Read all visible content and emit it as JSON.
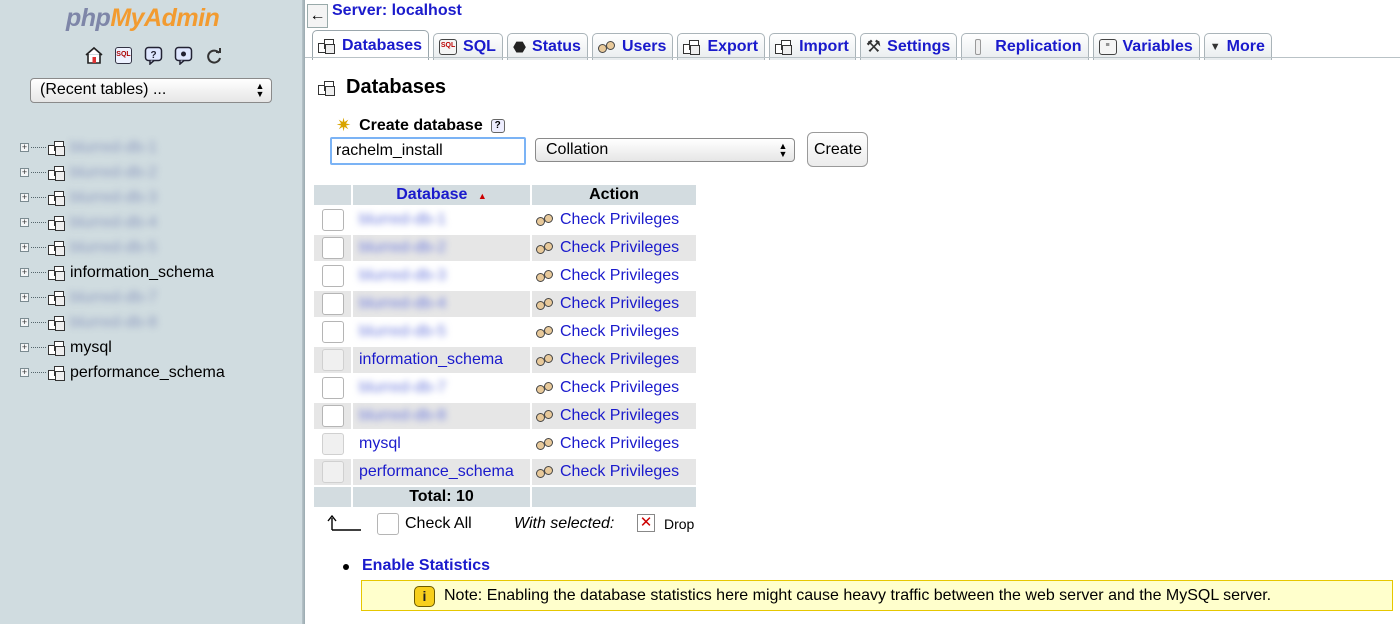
{
  "nav": {
    "logo_part1": "php",
    "logo_part2": "MyAdmin",
    "icons": [
      "home-icon",
      "sql-icon",
      "query-window-icon",
      "docs-icon",
      "reload-icon"
    ],
    "recent_tables": "(Recent tables) ...",
    "tree": [
      {
        "label": "blurred-db-1",
        "blurred": true
      },
      {
        "label": "blurred-db-2",
        "blurred": true
      },
      {
        "label": "blurred-db-3",
        "blurred": true
      },
      {
        "label": "blurred-db-4",
        "blurred": true
      },
      {
        "label": "blurred-db-5",
        "blurred": true
      },
      {
        "label": "information_schema",
        "blurred": false
      },
      {
        "label": "blurred-db-7",
        "blurred": true
      },
      {
        "label": "blurred-db-8",
        "blurred": true
      },
      {
        "label": "mysql",
        "blurred": false
      },
      {
        "label": "performance_schema",
        "blurred": false
      }
    ]
  },
  "header": {
    "back_arrow": "←",
    "breadcrumb": "Server: localhost"
  },
  "tabs": [
    {
      "label": "Databases",
      "icon": "databases-icon",
      "active": true
    },
    {
      "label": "SQL",
      "icon": "sql-icon",
      "active": false
    },
    {
      "label": "Status",
      "icon": "status-icon",
      "active": false
    },
    {
      "label": "Users",
      "icon": "users-icon",
      "active": false
    },
    {
      "label": "Export",
      "icon": "export-icon",
      "active": false
    },
    {
      "label": "Import",
      "icon": "import-icon",
      "active": false
    },
    {
      "label": "Settings",
      "icon": "settings-icon",
      "active": false
    },
    {
      "label": "Replication",
      "icon": "replication-icon",
      "active": false
    },
    {
      "label": "Variables",
      "icon": "variables-icon",
      "active": false
    },
    {
      "label": "More",
      "icon": "chevron-down-icon",
      "active": false
    }
  ],
  "page": {
    "title": "Databases",
    "create_label": "Create database",
    "dbname_value": "rachelm_install",
    "collation_value": "Collation",
    "create_button": "Create"
  },
  "table": {
    "columns": [
      "Database",
      "Action"
    ],
    "sort_indicator": "▲",
    "rows": [
      {
        "name": "blurred-db-1",
        "blurred": true,
        "action": "Check Privileges"
      },
      {
        "name": "blurred-db-2",
        "blurred": true,
        "action": "Check Privileges"
      },
      {
        "name": "blurred-db-3",
        "blurred": true,
        "action": "Check Privileges"
      },
      {
        "name": "blurred-db-4",
        "blurred": true,
        "action": "Check Privileges"
      },
      {
        "name": "blurred-db-5",
        "blurred": true,
        "action": "Check Privileges"
      },
      {
        "name": "information_schema",
        "blurred": false,
        "action": "Check Privileges"
      },
      {
        "name": "blurred-db-7",
        "blurred": true,
        "action": "Check Privileges"
      },
      {
        "name": "blurred-db-8",
        "blurred": true,
        "action": "Check Privileges"
      },
      {
        "name": "mysql",
        "blurred": false,
        "action": "Check Privileges"
      },
      {
        "name": "performance_schema",
        "blurred": false,
        "action": "Check Privileges"
      }
    ],
    "total": "Total: 10"
  },
  "footer": {
    "check_all": "Check All",
    "with_selected": "With selected:",
    "drop": "Drop",
    "enable_stats": "Enable Statistics",
    "notice": "Note: Enabling the database statistics here might cause heavy traffic between the web server and the MySQL server."
  },
  "colors": {
    "link": "#1a1acc",
    "nav_bg": "#d0dce0",
    "notice_bg": "#ffffcc"
  }
}
